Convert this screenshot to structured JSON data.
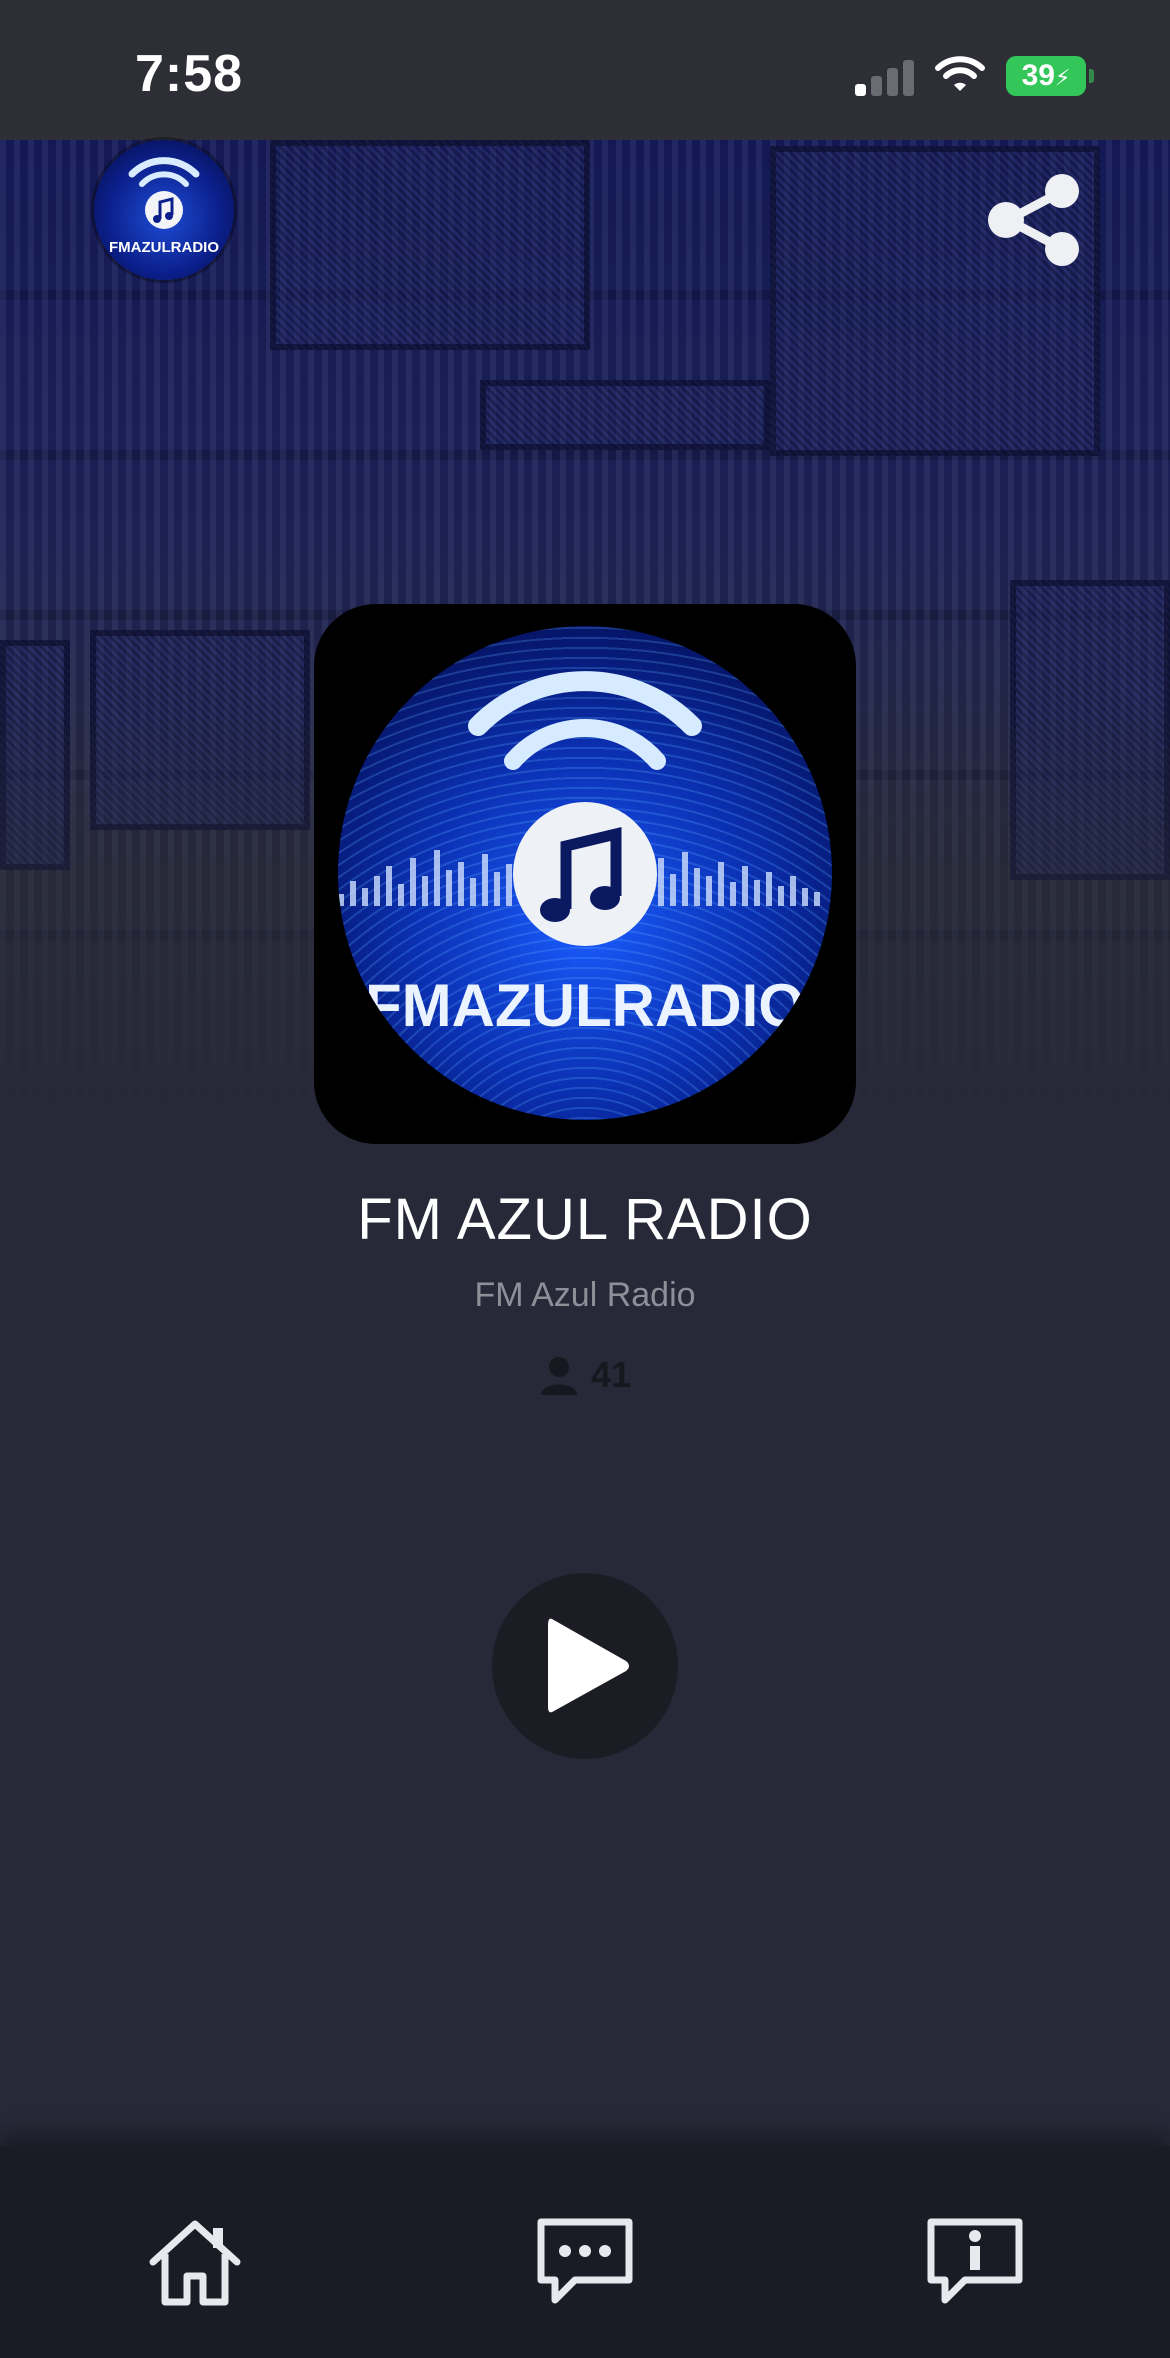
{
  "status_bar": {
    "time": "7:58",
    "battery_level": "39",
    "battery_color": "#33c759"
  },
  "header": {
    "logo_icon": "fm-azul-radio-logo",
    "share_icon": "share-icon"
  },
  "artwork": {
    "brand_text": "FMAZULRADIO"
  },
  "station": {
    "title": "FM AZUL RADIO",
    "subtitle": "FM Azul Radio",
    "listeners_icon": "person-icon",
    "listeners_count": "41"
  },
  "player": {
    "play_icon": "play-icon"
  },
  "tab_bar": {
    "items": [
      {
        "icon": "home-icon"
      },
      {
        "icon": "chat-icon"
      },
      {
        "icon": "info-icon"
      }
    ]
  },
  "colors": {
    "background": "#272938",
    "accent": "#1a5cff",
    "tab_bar": "#1a1b24"
  }
}
